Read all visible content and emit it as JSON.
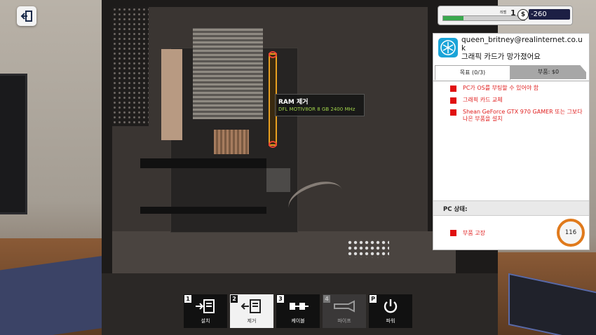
{
  "hud": {
    "level_label": "레벨",
    "level": "1",
    "currency_symbol": "$",
    "money": "-260",
    "xp_progress": 0.25
  },
  "tooltip": {
    "action": "RAM 제거",
    "item": "DFL MOTIV8OR 8 GB 2400 MHz"
  },
  "email": {
    "sender": "queen_britney@realinternet.co.uk",
    "subject": "그래픽 카드가 망가졌어요",
    "tabs": [
      {
        "label": "목표 (0/3)",
        "selected": true
      },
      {
        "label": "부품: $0",
        "selected": false
      }
    ],
    "goals": [
      "PC가 OS를 부팅할 수 있어야 함",
      "그래픽 카드 교체",
      "Shean GeForce GTX 970 GAMER 또는 그보다 나은 부품을 설치"
    ],
    "status_label": "PC 상태:",
    "status_item": "부품 고장",
    "status_value": "116",
    "accent_color": "#e07a1c",
    "goal_color": "#e02020"
  },
  "toolbar": {
    "tools": [
      {
        "key": "1",
        "label": "설치",
        "icon": "install-icon",
        "state": "normal"
      },
      {
        "key": "2",
        "label": "제거",
        "icon": "remove-icon",
        "state": "active"
      },
      {
        "key": "3",
        "label": "케이블",
        "icon": "cable-icon",
        "state": "normal"
      },
      {
        "key": "4",
        "label": "파이프",
        "icon": "pipe-icon",
        "state": "disabled"
      },
      {
        "key": "P",
        "label": "파워",
        "icon": "power-icon",
        "state": "normal"
      }
    ]
  }
}
